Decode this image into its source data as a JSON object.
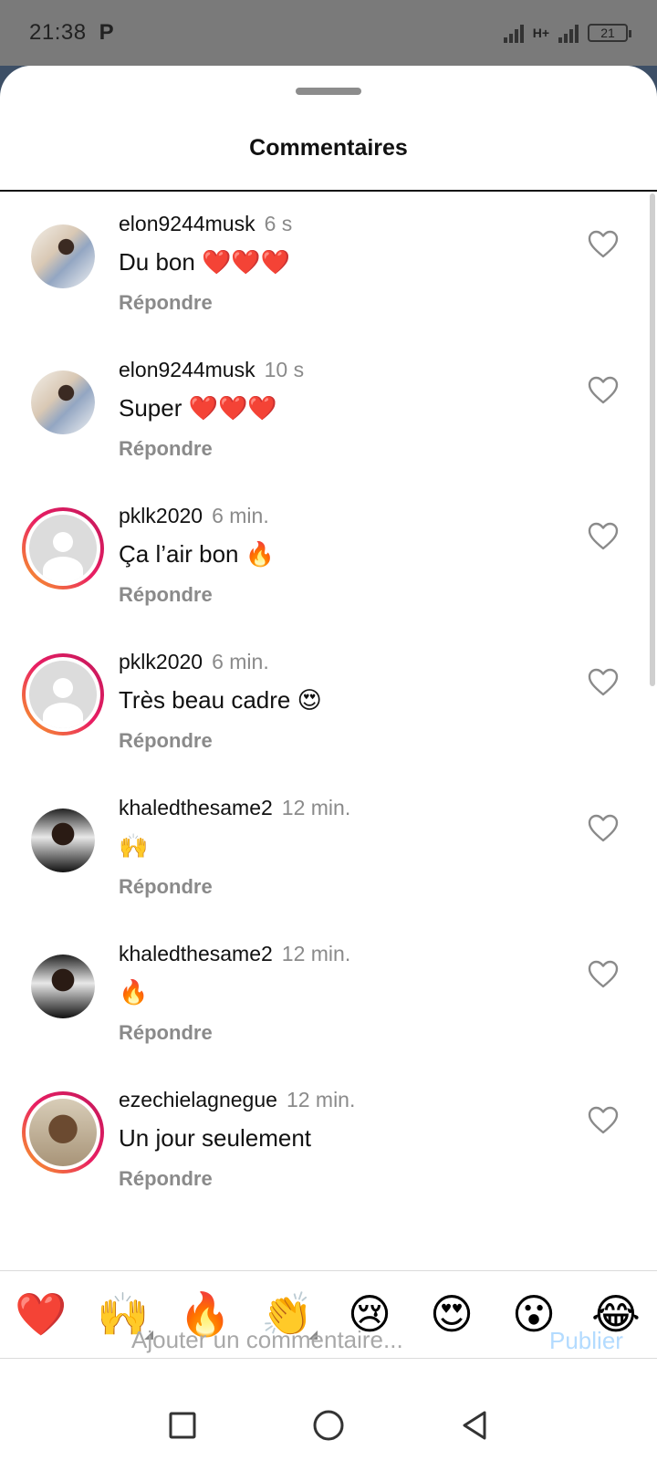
{
  "status_bar": {
    "time": "21:38",
    "app_indicator": "P",
    "network": "H+",
    "battery": "21"
  },
  "sheet": {
    "title": "Commentaires"
  },
  "comments": [
    {
      "username": "elon9244musk",
      "time": "6 s",
      "text": "Du bon ❤️❤️❤️",
      "reply_label": "Répondre",
      "avatar": "photo-a",
      "story_ring": false
    },
    {
      "username": "elon9244musk",
      "time": "10 s",
      "text": "Super ❤️❤️❤️",
      "reply_label": "Répondre",
      "avatar": "photo-a",
      "story_ring": false
    },
    {
      "username": "pklk2020",
      "time": "6 min.",
      "text": "Ça l’air bon 🔥",
      "reply_label": "Répondre",
      "avatar": "default",
      "story_ring": true
    },
    {
      "username": "pklk2020",
      "time": "6 min.",
      "text": "Très beau cadre 😍",
      "reply_label": "Répondre",
      "avatar": "default",
      "story_ring": true
    },
    {
      "username": "khaledthesame2",
      "time": "12 min.",
      "text": "🙌",
      "reply_label": "Répondre",
      "avatar": "photo-b",
      "story_ring": false
    },
    {
      "username": "khaledthesame2",
      "time": "12 min.",
      "text": "🔥",
      "reply_label": "Répondre",
      "avatar": "photo-b",
      "story_ring": false
    },
    {
      "username": "ezechielagnegue",
      "time": "12 min.",
      "text": "Un jour seulement",
      "reply_label": "Répondre",
      "avatar": "photo-c",
      "story_ring": true
    }
  ],
  "emoji_bar": [
    "❤️",
    "🙌",
    "🔥",
    "👏",
    "😢",
    "😍",
    "😮",
    "😂"
  ],
  "compose": {
    "placeholder": "Ajouter un commentaire...",
    "publish_label": "Publier"
  },
  "colors": {
    "accent_publish_disabled": "#b3dbff",
    "muted_text": "#8a8a8a",
    "story_ring_start": "#f9a825",
    "story_ring_end": "#c2185b"
  },
  "icons": {
    "like": "heart-outline-icon",
    "nav_recent": "square-icon",
    "nav_home": "circle-icon",
    "nav_back": "triangle-back-icon"
  }
}
